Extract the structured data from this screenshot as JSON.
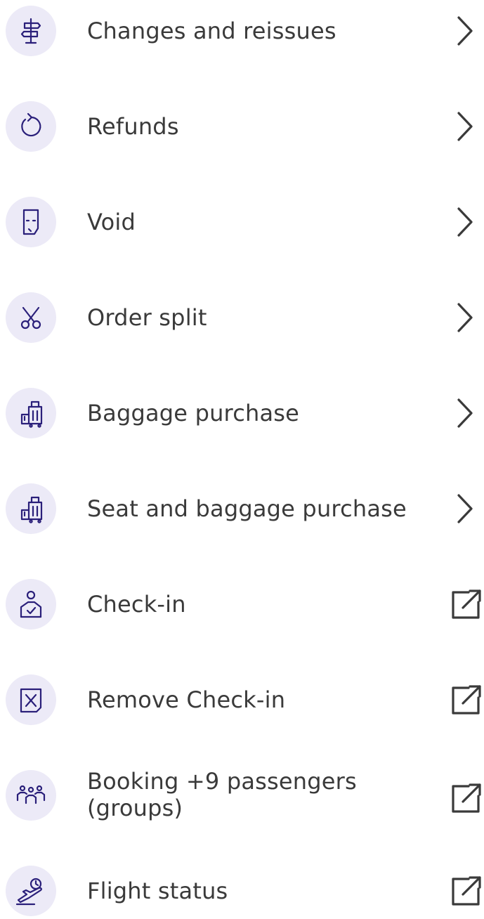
{
  "colors": {
    "icon_stroke": "#2a1f7a",
    "icon_bg": "#eceaf7",
    "label_text": "#3a3a3a",
    "trailing_icon": "#3a3a3a"
  },
  "menu": {
    "items": [
      {
        "label": "Changes and reissues",
        "icon": "signpost-icon",
        "trailing": "chevron-right-icon"
      },
      {
        "label": "Refunds",
        "icon": "refund-arrow-icon",
        "trailing": "chevron-right-icon"
      },
      {
        "label": "Void",
        "icon": "void-document-icon",
        "trailing": "chevron-right-icon"
      },
      {
        "label": "Order split",
        "icon": "scissors-icon",
        "trailing": "chevron-right-icon"
      },
      {
        "label": "Baggage purchase",
        "icon": "luggage-icon",
        "trailing": "chevron-right-icon"
      },
      {
        "label": "Seat and baggage purchase",
        "icon": "luggage-icon",
        "trailing": "chevron-right-icon"
      },
      {
        "label": "Check-in",
        "icon": "person-check-icon",
        "trailing": "external-link-icon"
      },
      {
        "label": "Remove Check-in",
        "icon": "remove-checkin-icon",
        "trailing": "external-link-icon"
      },
      {
        "label": "Booking +9 passengers (groups)",
        "icon": "group-icon",
        "trailing": "external-link-icon"
      },
      {
        "label": "Flight status",
        "icon": "flight-status-icon",
        "trailing": "external-link-icon"
      }
    ]
  }
}
